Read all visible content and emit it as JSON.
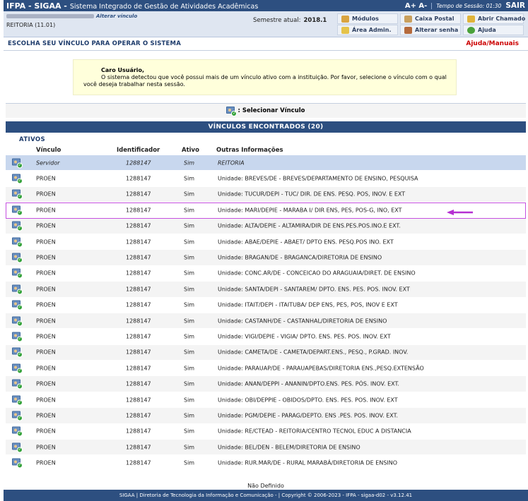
{
  "topbar": {
    "app": "IFPA - SIGAA -",
    "subtitle": "Sistema Integrado de Gestão de Atividades Acadêmicas",
    "font_size": "A+ A-",
    "session_label": "Tempo de Sessão:",
    "session_time": "01:30",
    "logout": "SAIR"
  },
  "user": {
    "alter_link": "Alterar vínculo",
    "unit": "REITORIA (11.01)"
  },
  "semester": {
    "label": "Semestre atual:",
    "value": "2018.1"
  },
  "modlinks": {
    "modulos": "Módulos",
    "caixa": "Caixa Postal",
    "chamado": "Abrir Chamado",
    "area_admin": "Área Admin.",
    "senha": "Alterar senha",
    "ajuda": "Ajuda"
  },
  "page": {
    "title": "ESCOLHA SEU VÍNCULO PARA OPERAR O SISTEMA",
    "help": "Ajuda/Manuais"
  },
  "message": {
    "greeting": "Caro Usuário,",
    "text": "O sistema detectou que você possui mais de um vínculo ativo com a instituição. Por favor, selecione o vínculo com o qual você deseja trabalhar nesta sessão."
  },
  "select_link": ": Selecionar Vínculo",
  "table": {
    "title": "VÍNCULOS ENCONTRADOS (20)",
    "section": "ATIVOS",
    "headers": {
      "vinculo": "Vínculo",
      "identificador": "Identificador",
      "ativo": "Ativo",
      "outras": "Outras Informações"
    }
  },
  "rows": [
    {
      "vinculo": "Servidor",
      "id": "1288147",
      "ativo": "Sim",
      "info": "REITORIA"
    },
    {
      "vinculo": "PROEN",
      "id": "1288147",
      "ativo": "Sim",
      "info": "Unidade: BREVES/DE - BREVES/DEPARTAMENTO DE ENSINO, PESQUISA"
    },
    {
      "vinculo": "PROEN",
      "id": "1288147",
      "ativo": "Sim",
      "info": "Unidade: TUCUR/DEPI - TUC/ DIR. DE ENS. PESQ. POS, INOV. E EXT"
    },
    {
      "vinculo": "PROEN",
      "id": "1288147",
      "ativo": "Sim",
      "info": "Unidade: MARI/DEPIE - MARABA I/ DIR ENS, PES, POS-G, INO, EXT"
    },
    {
      "vinculo": "PROEN",
      "id": "1288147",
      "ativo": "Sim",
      "info": "Unidade: ALTA/DEPIE - ALTAMIRA/DIR DE ENS.PES.POS.INO.E EXT."
    },
    {
      "vinculo": "PROEN",
      "id": "1288147",
      "ativo": "Sim",
      "info": "Unidade: ABAE/DEPIE - ABAET/ DPTO ENS. PESQ.POS INO. EXT"
    },
    {
      "vinculo": "PROEN",
      "id": "1288147",
      "ativo": "Sim",
      "info": "Unidade: BRAGAN/DE - BRAGANCA/DIRETORIA DE ENSINO"
    },
    {
      "vinculo": "PROEN",
      "id": "1288147",
      "ativo": "Sim",
      "info": "Unidade: CONC.AR/DE - CONCEICAO DO ARAGUAIA/DIRET. DE ENSINO"
    },
    {
      "vinculo": "PROEN",
      "id": "1288147",
      "ativo": "Sim",
      "info": "Unidade: SANTA/DEPI - SANTAREM/ DPTO. ENS. PES. POS. INOV. EXT"
    },
    {
      "vinculo": "PROEN",
      "id": "1288147",
      "ativo": "Sim",
      "info": "Unidade: ITAIT/DEPI - ITAITUBA/ DEP ENS, PES, POS, INOV E EXT"
    },
    {
      "vinculo": "PROEN",
      "id": "1288147",
      "ativo": "Sim",
      "info": "Unidade: CASTANH/DE - CASTANHAL/DIRETORIA DE ENSINO"
    },
    {
      "vinculo": "PROEN",
      "id": "1288147",
      "ativo": "Sim",
      "info": "Unidade: VIGI/DEPIE - VIGIA/ DPTO. ENS. PES. POS. INOV. EXT"
    },
    {
      "vinculo": "PROEN",
      "id": "1288147",
      "ativo": "Sim",
      "info": "Unidade: CAMETA/DE - CAMETA/DEPART.ENS., PESQ., P.GRAD. INOV."
    },
    {
      "vinculo": "PROEN",
      "id": "1288147",
      "ativo": "Sim",
      "info": "Unidade: PARAUAP/DE - PARAUAPEBAS/DIRETORIA ENS.,PESQ.EXTENSÃO"
    },
    {
      "vinculo": "PROEN",
      "id": "1288147",
      "ativo": "Sim",
      "info": "Unidade: ANAN/DEPPI - ANANIN/DPTO.ENS. PES. PÓS. INOV. EXT."
    },
    {
      "vinculo": "PROEN",
      "id": "1288147",
      "ativo": "Sim",
      "info": "Unidade: OBI/DEPPIE - OBIDOS/DPTO. ENS. PES. POS. INOV. EXT"
    },
    {
      "vinculo": "PROEN",
      "id": "1288147",
      "ativo": "Sim",
      "info": "Unidade: PGM/DEPIE - PARAG/DEPTO. ENS .PES. POS. INOV. EXT."
    },
    {
      "vinculo": "PROEN",
      "id": "1288147",
      "ativo": "Sim",
      "info": "Unidade: RE/CTEAD - REITORIA/CENTRO TECNOL EDUC A DISTANCIA"
    },
    {
      "vinculo": "PROEN",
      "id": "1288147",
      "ativo": "Sim",
      "info": "Unidade: BEL/DEN - BELEM/DIRETORIA DE ENSINO"
    },
    {
      "vinculo": "PROEN",
      "id": "1288147",
      "ativo": "Sim",
      "info": "Unidade: RUR.MAR/DE - RURAL MARABÁ/DIRETORIA DE ENSINO"
    }
  ],
  "footer_note": "Não Definido",
  "footer": "SIGAA | Diretoria de Tecnologia da Informação e Comunicação - | Copyright © 2006-2023 - IFPA - sigaa-d02 - v3.12.41"
}
